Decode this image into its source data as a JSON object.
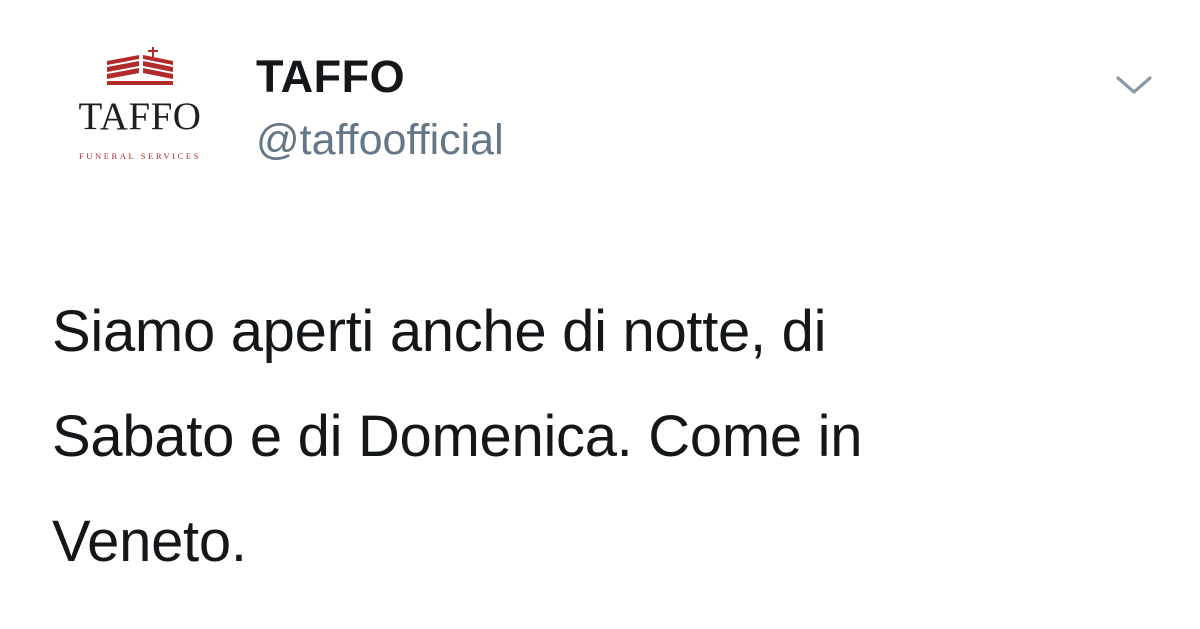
{
  "tweet": {
    "avatar": {
      "wordmark": "TAFFO",
      "tagline": "FUNERAL SERVICES",
      "icon": "colosseum-cross-logo-icon",
      "brand_color": "#b22b2b"
    },
    "author": {
      "display_name": "TAFFO",
      "handle": "@taffoofficial"
    },
    "menu_icon": "chevron-down-icon",
    "text_lines": [
      "Siamo aperti anche di notte, di",
      "Sabato e di Domenica. Come in",
      "Veneto."
    ]
  },
  "colors": {
    "text": "#14171a",
    "secondary": "#657786",
    "chevron": "#8899a6",
    "brand": "#b22b2b"
  }
}
